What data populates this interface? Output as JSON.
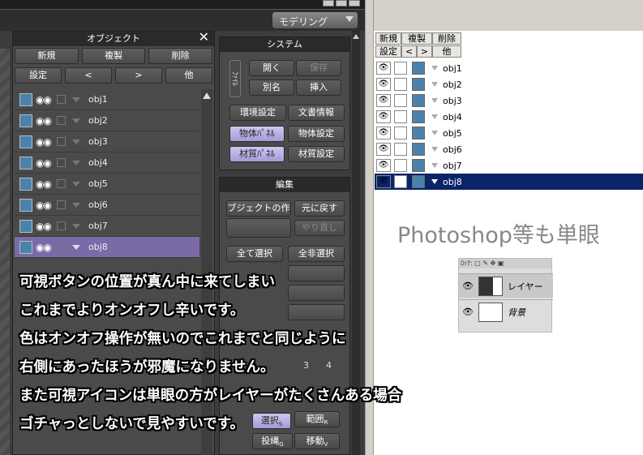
{
  "top": {
    "mode_select": "モデリング"
  },
  "object_panel": {
    "title": "オブジェクト",
    "buttons_row1": [
      "新規",
      "複製",
      "削除"
    ],
    "buttons_row2": [
      "設定",
      "<",
      ">",
      "他"
    ],
    "objects": [
      "obj1",
      "obj2",
      "obj3",
      "obj4",
      "obj5",
      "obj6",
      "obj7",
      "obj8"
    ],
    "selected": "obj8",
    "swatch_color": "#4a82ab",
    "selected_color": "#7a6aa8"
  },
  "system_panel": {
    "title": "システム",
    "tab_file": "ﾌｧｲﾙ",
    "open": "開く",
    "save": "保存",
    "save_as": "別名",
    "insert": "挿入",
    "env_settings": "環境設定",
    "doc_info": "文書情報",
    "object_panel_btn": "物体ﾊﾟﾈﾙ",
    "object_settings": "物体設定",
    "material_panel_btn": "材質ﾊﾟﾈﾙ",
    "material_settings": "材質設定"
  },
  "edit_panel": {
    "title": "編集",
    "object_op": "ブジェクトの作",
    "undo": "元に戻す",
    "redo": "やり直し",
    "select_all": "全て選択",
    "deselect_all": "全非選択",
    "numbers": [
      "3",
      "4"
    ],
    "select_btn": "選択",
    "select_key": "S",
    "range_btn": "範囲",
    "range_key": "R",
    "move_btn": "投縄",
    "move_key": "G",
    "move2_btn": "移動",
    "move2_key": "V"
  },
  "right_panel": {
    "buttons_row1": [
      "新規",
      "複製",
      "削除"
    ],
    "buttons_row2": [
      "設定",
      "<",
      ">",
      "他"
    ],
    "layers": [
      "obj1",
      "obj2",
      "obj3",
      "obj4",
      "obj5",
      "obj6",
      "obj7",
      "obj8"
    ],
    "selected": "obj8",
    "selected_color": "#0a246a"
  },
  "photoshop": {
    "label": "Photoshop等も単眼",
    "layer1": "レイヤー",
    "layer2": "背景"
  },
  "overlay_text": [
    "可視ボタンの位置が真ん中に来てしまい",
    "これまでよりオンオフし辛いです。",
    "色はオンオフ操作が無いのでこれまでと同じように",
    "右側にあったほうが邪魔になりません。",
    "また可視アイコンは単眼の方がレイヤーがたくさんある場合",
    "ゴチャっとしないで見やすいです。"
  ]
}
